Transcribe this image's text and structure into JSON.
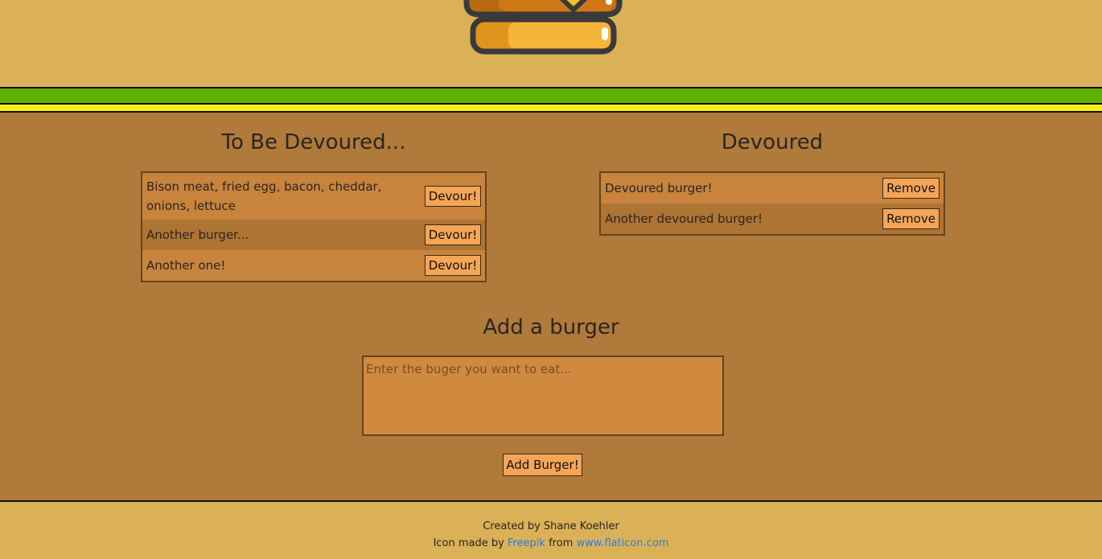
{
  "to_devour": {
    "title": "To Be Devoured...",
    "button_label": "Devour!",
    "items": [
      "Bison meat, fried egg, bacon, cheddar, onions, lettuce",
      "Another burger...",
      "Another one!"
    ]
  },
  "devoured": {
    "title": "Devoured",
    "button_label": "Remove",
    "items": [
      "Devoured burger!",
      "Another devoured burger!"
    ]
  },
  "add": {
    "title": "Add a burger",
    "placeholder": "Enter the buger you want to eat...",
    "button_label": "Add Burger!"
  },
  "footer": {
    "created_by": "Created by Shane Koehler",
    "icon_prefix": "Icon made by",
    "author_link": "Freepik",
    "from_text": "from",
    "site_link": "www.flaticon.com"
  },
  "colors": {
    "page_bg": "#dbb158",
    "main_bg": "#b07a3a",
    "stripe_green": "#5fb000",
    "stripe_yellow": "#f5ee17",
    "button_bg": "#f4a556",
    "link": "#2a7ae2"
  }
}
